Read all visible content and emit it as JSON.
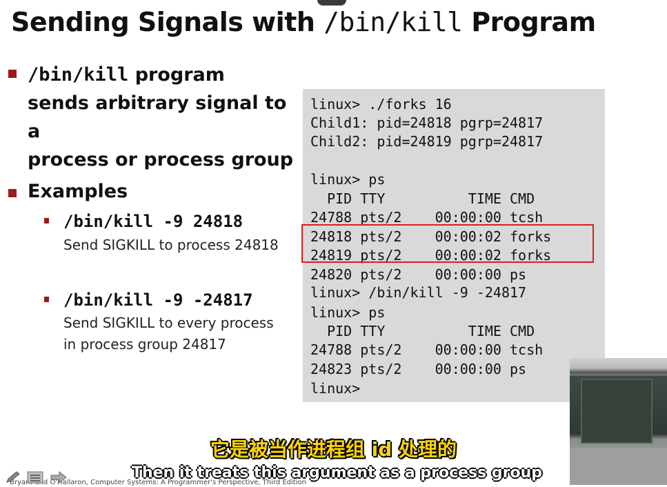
{
  "title": {
    "prefix": "Sending Signals with ",
    "code": "/bin/kill",
    "suffix": " Program"
  },
  "bullets": {
    "first": {
      "code": "/bin/kill",
      "text_line1": " program",
      "text_line2": "sends arbitrary signal to a",
      "text_line3": "process or process group"
    },
    "examples_label": "Examples",
    "examples": [
      {
        "command": "/bin/kill -9 24818",
        "desc_line1": "Send SIGKILL to process 24818",
        "desc_line2": ""
      },
      {
        "command": "/bin/kill -9 -24817",
        "desc_line1": "Send SIGKILL to every process",
        "desc_line2": "in process group 24817"
      }
    ]
  },
  "terminal": {
    "lines": [
      "linux> ./forks 16",
      "Child1: pid=24818 pgrp=24817",
      "Child2: pid=24819 pgrp=24817",
      "",
      "linux> ps",
      "  PID TTY          TIME CMD",
      "24788 pts/2    00:00:00 tcsh",
      "24818 pts/2    00:00:02 forks",
      "24819 pts/2    00:00:02 forks",
      "24820 pts/2    00:00:00 ps",
      "linux> /bin/kill -9 -24817",
      "linux> ps",
      "  PID TTY          TIME CMD",
      "24788 pts/2    00:00:00 tcsh",
      "24823 pts/2    00:00:00 ps",
      "linux>"
    ],
    "highlight_color": "#d42020",
    "background": "#d9d9d9"
  },
  "subtitles": {
    "chinese": "它是被当作进程组 id 处理的",
    "english": "Then it treats this argument as a process group"
  },
  "footer": {
    "text": "Bryant and O'Hallaron, Computer Systems: A Programmer's Perspective, Third Edition"
  },
  "colors": {
    "bullet": "#9b1b1b",
    "subtitle_cn": "#ffd400"
  },
  "icons": [
    "pen-icon",
    "menu-icon",
    "arrow-right-icon"
  ]
}
